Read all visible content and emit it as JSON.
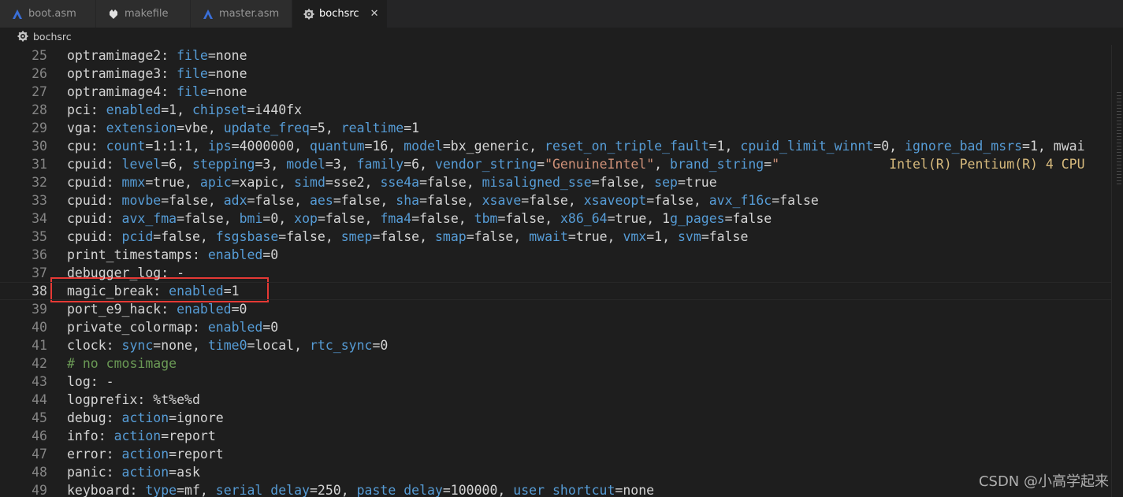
{
  "tabs": [
    {
      "label": "boot.asm",
      "icon": "asm-file-icon",
      "active": false
    },
    {
      "label": "makefile",
      "icon": "makefile-icon",
      "active": false
    },
    {
      "label": "master.asm",
      "icon": "asm-file-icon",
      "active": false
    },
    {
      "label": "bochsrc",
      "icon": "gear-icon",
      "active": true
    }
  ],
  "breadcrumb": {
    "file": "bochsrc"
  },
  "lines": [
    {
      "n": "25",
      "code": "optramimage2: file=none"
    },
    {
      "n": "26",
      "code": "optramimage3: file=none"
    },
    {
      "n": "27",
      "code": "optramimage4: file=none"
    },
    {
      "n": "28",
      "code": "pci: enabled=1, chipset=i440fx"
    },
    {
      "n": "29",
      "code": "vga: extension=vbe, update_freq=5, realtime=1"
    },
    {
      "n": "30",
      "code": "cpu: count=1:1:1, ips=4000000, quantum=16, model=bx_generic, reset_on_triple_fault=1, cpuid_limit_winnt=0, ignore_bad_msrs=1, mwai"
    },
    {
      "n": "31",
      "code": "cpuid: level=6, stepping=3, model=3, family=6, vendor_string=\"GenuineIntel\", brand_string=\"              Intel(R) Pentium(R) 4 CPU"
    },
    {
      "n": "32",
      "code": "cpuid: mmx=true, apic=xapic, simd=sse2, sse4a=false, misaligned_sse=false, sep=true"
    },
    {
      "n": "33",
      "code": "cpuid: movbe=false, adx=false, aes=false, sha=false, xsave=false, xsaveopt=false, avx_f16c=false"
    },
    {
      "n": "34",
      "code": "cpuid: avx_fma=false, bmi=0, xop=false, fma4=false, tbm=false, x86_64=true, 1g_pages=false"
    },
    {
      "n": "35",
      "code": "cpuid: pcid=false, fsgsbase=false, smep=false, smap=false, mwait=true, vmx=1, svm=false"
    },
    {
      "n": "36",
      "code": "print_timestamps: enabled=0"
    },
    {
      "n": "37",
      "code": "debugger_log: -"
    },
    {
      "n": "38",
      "code": "magic_break: enabled=1"
    },
    {
      "n": "39",
      "code": "port_e9_hack: enabled=0"
    },
    {
      "n": "40",
      "code": "private_colormap: enabled=0"
    },
    {
      "n": "41",
      "code": "clock: sync=none, time0=local, rtc_sync=0"
    },
    {
      "n": "42",
      "code": "# no cmosimage"
    },
    {
      "n": "43",
      "code": "log: -"
    },
    {
      "n": "44",
      "code": "logprefix: %t%e%d"
    },
    {
      "n": "45",
      "code": "debug: action=ignore"
    },
    {
      "n": "46",
      "code": "info: action=report"
    },
    {
      "n": "47",
      "code": "error: action=report"
    },
    {
      "n": "48",
      "code": "panic: action=ask"
    },
    {
      "n": "49",
      "code": "keyboard: type=mf, serial_delay=250, paste_delay=100000, user_shortcut=none"
    }
  ],
  "current_line": "38",
  "watermark": "CSDN @小高学起来",
  "colors": {
    "keyword": "#569cd6",
    "string": "#ce9178",
    "comment": "#6a9955",
    "plain": "#d4d4d4",
    "highlight_box": "#e53935"
  }
}
